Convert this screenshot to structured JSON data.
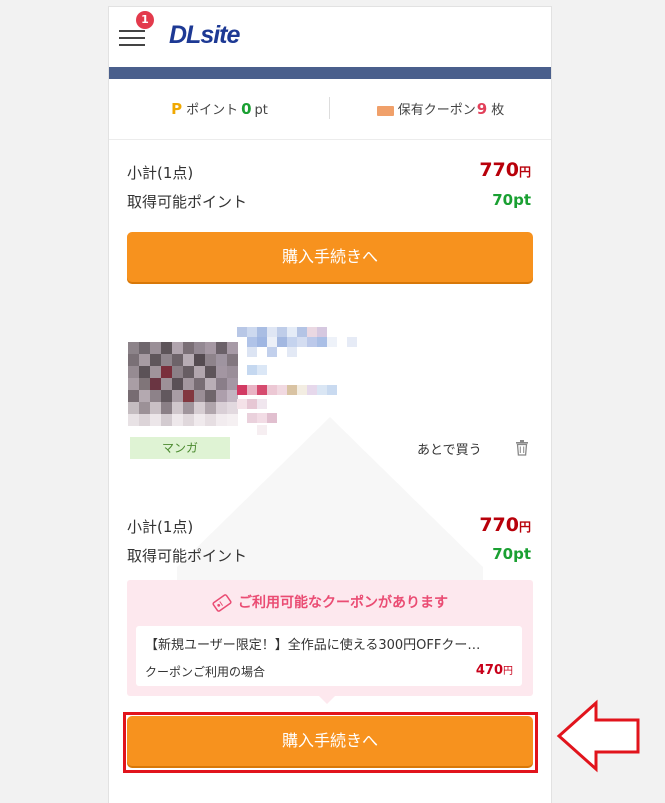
{
  "header": {
    "logo_text": "DLsite",
    "cart_badge_count": "1"
  },
  "summary": {
    "points_icon": "P",
    "points_label": "ポイント",
    "points_value": "0",
    "points_unit": "pt",
    "coupon_label": "保有クーポン",
    "coupon_value": "9",
    "coupon_unit": "枚"
  },
  "cart_total": {
    "subtotal_label": "小計(1点)",
    "price": "770",
    "price_unit": "円",
    "points_label": "取得可能ポイント",
    "points": "70pt",
    "checkout_button": "購入手続きへ"
  },
  "item": {
    "category_tag": "マンガ",
    "later_link": "あとで買う",
    "subtotal_label": "小計(1点)",
    "price": "770",
    "price_unit": "円",
    "points_label": "取得可能ポイント",
    "points": "70pt",
    "coupon_heading": "ご利用可能なクーポンがあります",
    "coupon_name": "【新規ユーザー限定！】全作品に使える300円OFFクー…",
    "coupon_condition": "クーポンご利用の場合",
    "coupon_price": "470",
    "coupon_price_unit": "円",
    "checkout_button": "購入手続きへ"
  },
  "colors": {
    "accent_orange": "#f7921e",
    "price_red": "#b8000a",
    "points_green": "#1aa032",
    "coupon_pink": "#ea4c73",
    "highlight_red": "#e1141c",
    "brand_navy": "#1d3994"
  }
}
